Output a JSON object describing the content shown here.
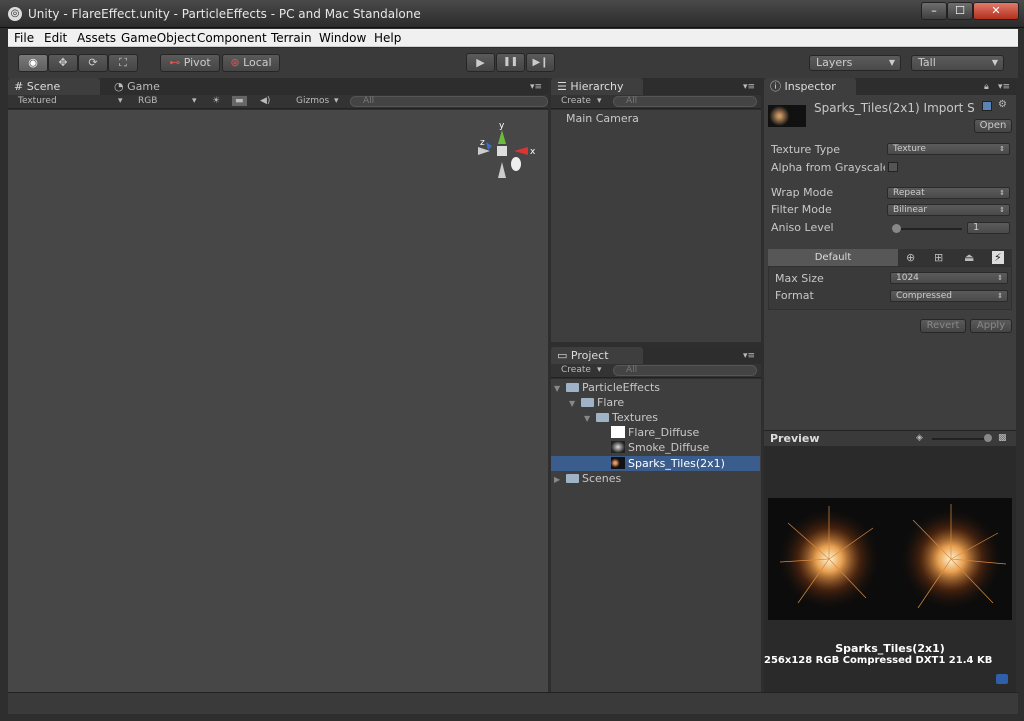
{
  "window": {
    "title": "Unity - FlareEffect.unity - ParticleEffects - PC and Mac Standalone",
    "min": "–",
    "max": "☐",
    "close": "✕"
  },
  "menu": [
    "File",
    "Edit",
    "Assets",
    "GameObject",
    "Component",
    "Terrain",
    "Window",
    "Help"
  ],
  "toolbar": {
    "tools": [
      "eye-icon",
      "move-icon",
      "rotate-icon",
      "scale-icon"
    ],
    "pivot": "Pivot",
    "local": "Local",
    "play": "▶",
    "pause": "❚❚",
    "step": "▶❙",
    "layers": "Layers",
    "layout": "Tall"
  },
  "scene": {
    "tabs": [
      "Scene",
      "Game"
    ],
    "render_mode": "Textured",
    "channel": "RGB",
    "gizmos": "Gizmos",
    "search_placeholder": "All",
    "axes": {
      "y": "y",
      "x": "x",
      "z": "z"
    }
  },
  "hierarchy": {
    "tab": "Hierarchy",
    "create": "Create",
    "search_placeholder": "All",
    "items": [
      "Main Camera"
    ]
  },
  "project": {
    "tab": "Project",
    "create": "Create",
    "search_placeholder": "All",
    "tree": {
      "root": "ParticleEffects",
      "flare": "Flare",
      "textures": "Textures",
      "files": [
        "Flare_Diffuse",
        "Smoke_Diffuse",
        "Sparks_Tiles(2x1)"
      ],
      "scenes": "Scenes"
    },
    "selected": "Sparks_Tiles(2x1)"
  },
  "inspector": {
    "tab": "Inspector",
    "asset_title": "Sparks_Tiles(2x1) Import S",
    "open": "Open",
    "texture_type_label": "Texture Type",
    "texture_type": "Texture",
    "alpha_label": "Alpha from Grayscale",
    "wrap_label": "Wrap Mode",
    "wrap": "Repeat",
    "filter_label": "Filter Mode",
    "filter": "Bilinear",
    "aniso_label": "Aniso Level",
    "aniso": "1",
    "platform_default": "Default",
    "max_size_label": "Max Size",
    "max_size": "1024",
    "format_label": "Format",
    "format": "Compressed",
    "revert": "Revert",
    "apply": "Apply"
  },
  "preview": {
    "label": "Preview",
    "name": "Sparks_Tiles(2x1)",
    "info": "256x128  RGB Compressed DXT1   21.4 KB"
  }
}
